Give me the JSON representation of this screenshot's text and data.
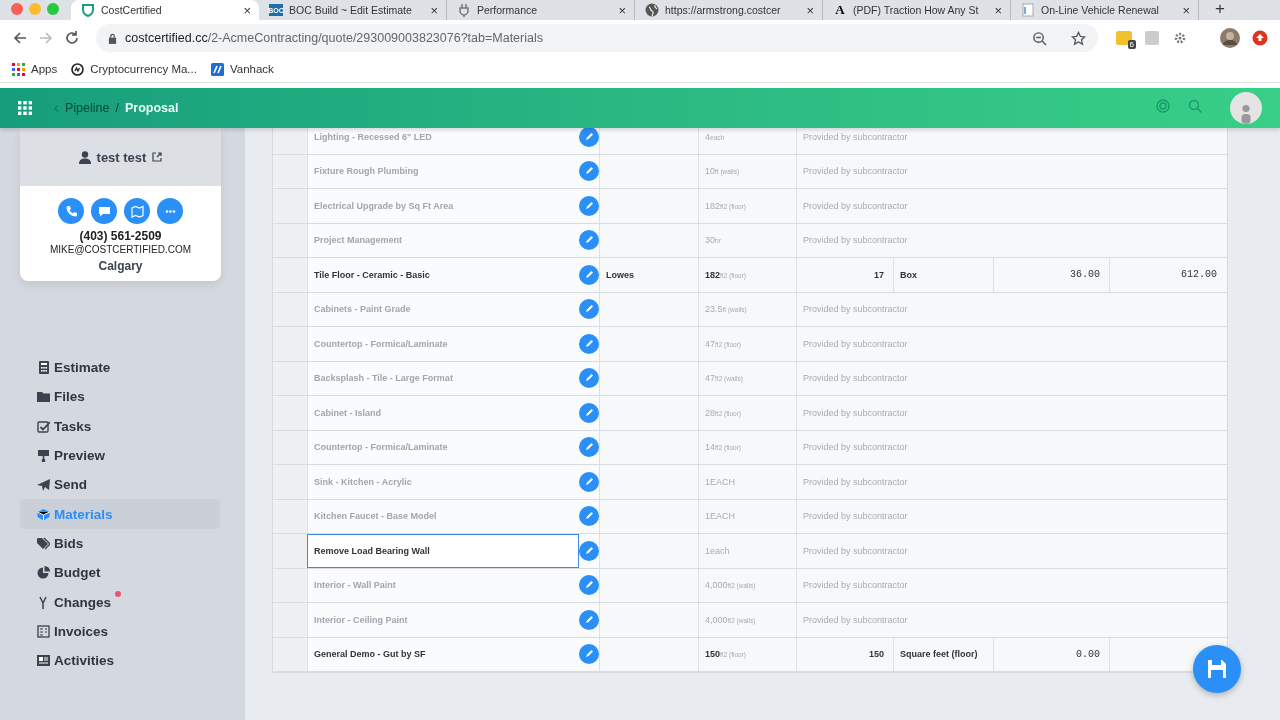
{
  "browser": {
    "tabs": [
      {
        "title": "CostCertified",
        "close": "×",
        "selected": true
      },
      {
        "title": "BOC Build ~ Edit Estimate",
        "favicon_text": "BOC",
        "close": "×",
        "selected": false
      },
      {
        "title": "Performance",
        "close": "×",
        "selected": false
      },
      {
        "title": "https://armstrong.costcer",
        "close": "×",
        "selected": false
      },
      {
        "title": "(PDF) Traction How Any St",
        "favicon_text": "A",
        "close": "×",
        "selected": false
      },
      {
        "title": "On-Line Vehicle Renewal",
        "close": "×",
        "selected": false
      }
    ],
    "new_tab": "+",
    "address": {
      "host": "costcertified.cc",
      "path": "/2-AcmeContracting/quote/293009003823076?tab=Materials"
    },
    "extension_badge": "6",
    "bookmarks": [
      {
        "label": "Apps"
      },
      {
        "label": "Cryptocurrency Ma..."
      },
      {
        "label": "Vanhack"
      }
    ]
  },
  "header": {
    "back": "Pipeline",
    "separator": "/",
    "current": "Proposal"
  },
  "contact": {
    "name": "test test",
    "phone": "(403) 561-2509",
    "email": "MIKE@COSTCERTIFIED.COM",
    "city": "Calgary"
  },
  "nav": {
    "items": [
      {
        "label": "Estimate",
        "selected": false,
        "alert": false
      },
      {
        "label": "Files",
        "selected": false,
        "alert": false
      },
      {
        "label": "Tasks",
        "selected": false,
        "alert": false
      },
      {
        "label": "Preview",
        "selected": false,
        "alert": false
      },
      {
        "label": "Send",
        "selected": false,
        "alert": false
      },
      {
        "label": "Materials",
        "selected": true,
        "alert": false
      },
      {
        "label": "Bids",
        "selected": false,
        "alert": false
      },
      {
        "label": "Budget",
        "selected": false,
        "alert": false
      },
      {
        "label": "Changes",
        "selected": false,
        "alert": true
      },
      {
        "label": "Invoices",
        "selected": false,
        "alert": false
      },
      {
        "label": "Activities",
        "selected": false,
        "alert": false
      }
    ]
  },
  "table": {
    "rows": [
      {
        "kind": "provided",
        "name": "Lighting - Recessed 6\" LED",
        "editing": false,
        "amount": "4",
        "unit": "each",
        "note": "Provided by subcontractor"
      },
      {
        "kind": "provided",
        "name": "Fixture Rough Plumbing",
        "editing": false,
        "amount": "10",
        "unit": "ft (walls)",
        "note": "Provided by subcontractor"
      },
      {
        "kind": "provided",
        "name": "Electrical Upgrade by Sq Ft Area",
        "editing": false,
        "amount": "182",
        "unit": "ft2 (floor)",
        "note": "Provided by subcontractor"
      },
      {
        "kind": "provided",
        "name": "Project Management",
        "editing": false,
        "amount": "30",
        "unit": "hr",
        "note": "Provided by subcontractor"
      },
      {
        "kind": "purchased",
        "name": "Tile Floor - Ceramic - Basic",
        "editing": false,
        "supplier": "Lowes",
        "amount": "182",
        "unit": "ft2 (floor)",
        "quantity": "17",
        "purchase_unit": "Box",
        "price": "36.00",
        "total": "612.00"
      },
      {
        "kind": "provided",
        "name": "Cabinets - Paint Grade",
        "editing": false,
        "amount": "23.5",
        "unit": "ft (walls)",
        "note": "Provided by subcontractor"
      },
      {
        "kind": "provided",
        "name": "Countertop - Formica/Laminate",
        "editing": false,
        "amount": "47",
        "unit": "ft2 (floor)",
        "note": "Provided by subcontractor"
      },
      {
        "kind": "provided",
        "name": "Backsplash - Tile - Large Format",
        "editing": false,
        "amount": "47",
        "unit": "ft2 (walls)",
        "note": "Provided by subcontractor"
      },
      {
        "kind": "provided",
        "name": "Cabinet - Island",
        "editing": false,
        "amount": "28",
        "unit": "ft2 (floor)",
        "note": "Provided by subcontractor"
      },
      {
        "kind": "provided",
        "name": "Countertop - Formica/Laminate",
        "editing": false,
        "amount": "14",
        "unit": "ft2 (floor)",
        "note": "Provided by subcontractor"
      },
      {
        "kind": "provided",
        "name": "Sink - Kitchen - Acrylic",
        "editing": false,
        "amount": "1EACH",
        "note": "Provided by subcontractor"
      },
      {
        "kind": "provided",
        "name": "Kitchen Faucet - Base Model",
        "editing": false,
        "amount": "1EACH",
        "note": "Provided by subcontractor"
      },
      {
        "kind": "provided",
        "name": "Remove Load Bearing Wall",
        "editing": true,
        "amount": "1each",
        "note": "Provided by subcontractor"
      },
      {
        "kind": "provided",
        "name": "Interior - Wall Paint",
        "editing": false,
        "amount": "4,000",
        "unit": "ft2 (walls)",
        "note": "Provided by subcontractor"
      },
      {
        "kind": "provided",
        "name": "Interior - Ceiling Paint",
        "editing": false,
        "amount": "4,000",
        "unit": "ft2 (walls)",
        "note": "Provided by subcontractor"
      },
      {
        "kind": "purchased",
        "name": "General Demo - Gut by SF",
        "editing": false,
        "amount": "150",
        "unit": "ft2 (floor)",
        "quantity": "150",
        "purchase_unit": "Square feet (floor)",
        "price": "0.00"
      }
    ]
  }
}
